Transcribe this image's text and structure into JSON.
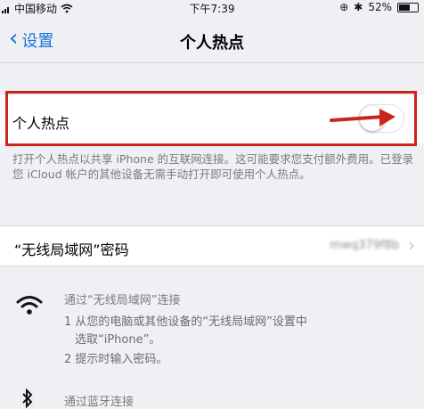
{
  "status_bar": {
    "carrier": "中国移动",
    "time": "下午7:39",
    "battery": "52%",
    "icons": [
      "signal-icon",
      "wifi-icon",
      "lock-rotation-icon",
      "bluetooth-icon",
      "battery-icon"
    ]
  },
  "nav": {
    "back_label": "设置",
    "title": "个人热点"
  },
  "hotspot": {
    "label": "个人热点",
    "toggle_on": false,
    "annotation_color": "#c9251d"
  },
  "description": "打开个人热点以共享 iPhone 的互联网连接。这可能要求您支付额外费用。已登录您 iCloud 帐户的其他设备无需手动打开即可使用个人热点。",
  "wifi_password": {
    "label": "“无线局域网”密码",
    "value": "mwq379f8b"
  },
  "instructions": {
    "wifi_title": "通过“无线局域网”连接",
    "wifi_step1_a": "1 从您的电脑或其他设备的“无线局域网”设置中",
    "wifi_step1_b": "选取“iPhone”。",
    "wifi_step2": "2 提示时输入密码。",
    "bt_title": "通过蓝牙连接"
  },
  "colors": {
    "accent": "#1a73d9",
    "background": "#efeff4",
    "highlight_box": "#c9251d"
  }
}
